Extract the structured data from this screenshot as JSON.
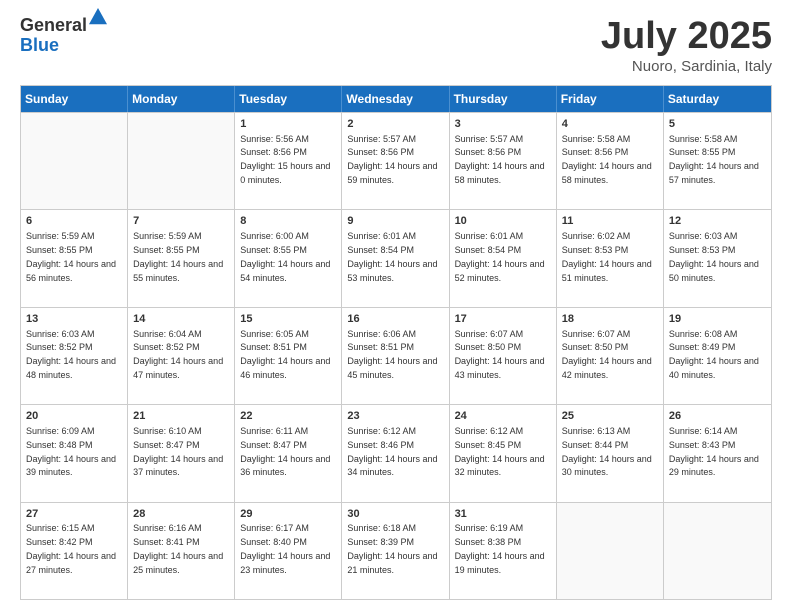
{
  "logo": {
    "general": "General",
    "blue": "Blue"
  },
  "header": {
    "month_year": "July 2025",
    "location": "Nuoro, Sardinia, Italy"
  },
  "weekdays": [
    "Sunday",
    "Monday",
    "Tuesday",
    "Wednesday",
    "Thursday",
    "Friday",
    "Saturday"
  ],
  "rows": [
    [
      {
        "day": "",
        "sunrise": "",
        "sunset": "",
        "daylight": ""
      },
      {
        "day": "",
        "sunrise": "",
        "sunset": "",
        "daylight": ""
      },
      {
        "day": "1",
        "sunrise": "Sunrise: 5:56 AM",
        "sunset": "Sunset: 8:56 PM",
        "daylight": "Daylight: 15 hours and 0 minutes."
      },
      {
        "day": "2",
        "sunrise": "Sunrise: 5:57 AM",
        "sunset": "Sunset: 8:56 PM",
        "daylight": "Daylight: 14 hours and 59 minutes."
      },
      {
        "day": "3",
        "sunrise": "Sunrise: 5:57 AM",
        "sunset": "Sunset: 8:56 PM",
        "daylight": "Daylight: 14 hours and 58 minutes."
      },
      {
        "day": "4",
        "sunrise": "Sunrise: 5:58 AM",
        "sunset": "Sunset: 8:56 PM",
        "daylight": "Daylight: 14 hours and 58 minutes."
      },
      {
        "day": "5",
        "sunrise": "Sunrise: 5:58 AM",
        "sunset": "Sunset: 8:55 PM",
        "daylight": "Daylight: 14 hours and 57 minutes."
      }
    ],
    [
      {
        "day": "6",
        "sunrise": "Sunrise: 5:59 AM",
        "sunset": "Sunset: 8:55 PM",
        "daylight": "Daylight: 14 hours and 56 minutes."
      },
      {
        "day": "7",
        "sunrise": "Sunrise: 5:59 AM",
        "sunset": "Sunset: 8:55 PM",
        "daylight": "Daylight: 14 hours and 55 minutes."
      },
      {
        "day": "8",
        "sunrise": "Sunrise: 6:00 AM",
        "sunset": "Sunset: 8:55 PM",
        "daylight": "Daylight: 14 hours and 54 minutes."
      },
      {
        "day": "9",
        "sunrise": "Sunrise: 6:01 AM",
        "sunset": "Sunset: 8:54 PM",
        "daylight": "Daylight: 14 hours and 53 minutes."
      },
      {
        "day": "10",
        "sunrise": "Sunrise: 6:01 AM",
        "sunset": "Sunset: 8:54 PM",
        "daylight": "Daylight: 14 hours and 52 minutes."
      },
      {
        "day": "11",
        "sunrise": "Sunrise: 6:02 AM",
        "sunset": "Sunset: 8:53 PM",
        "daylight": "Daylight: 14 hours and 51 minutes."
      },
      {
        "day": "12",
        "sunrise": "Sunrise: 6:03 AM",
        "sunset": "Sunset: 8:53 PM",
        "daylight": "Daylight: 14 hours and 50 minutes."
      }
    ],
    [
      {
        "day": "13",
        "sunrise": "Sunrise: 6:03 AM",
        "sunset": "Sunset: 8:52 PM",
        "daylight": "Daylight: 14 hours and 48 minutes."
      },
      {
        "day": "14",
        "sunrise": "Sunrise: 6:04 AM",
        "sunset": "Sunset: 8:52 PM",
        "daylight": "Daylight: 14 hours and 47 minutes."
      },
      {
        "day": "15",
        "sunrise": "Sunrise: 6:05 AM",
        "sunset": "Sunset: 8:51 PM",
        "daylight": "Daylight: 14 hours and 46 minutes."
      },
      {
        "day": "16",
        "sunrise": "Sunrise: 6:06 AM",
        "sunset": "Sunset: 8:51 PM",
        "daylight": "Daylight: 14 hours and 45 minutes."
      },
      {
        "day": "17",
        "sunrise": "Sunrise: 6:07 AM",
        "sunset": "Sunset: 8:50 PM",
        "daylight": "Daylight: 14 hours and 43 minutes."
      },
      {
        "day": "18",
        "sunrise": "Sunrise: 6:07 AM",
        "sunset": "Sunset: 8:50 PM",
        "daylight": "Daylight: 14 hours and 42 minutes."
      },
      {
        "day": "19",
        "sunrise": "Sunrise: 6:08 AM",
        "sunset": "Sunset: 8:49 PM",
        "daylight": "Daylight: 14 hours and 40 minutes."
      }
    ],
    [
      {
        "day": "20",
        "sunrise": "Sunrise: 6:09 AM",
        "sunset": "Sunset: 8:48 PM",
        "daylight": "Daylight: 14 hours and 39 minutes."
      },
      {
        "day": "21",
        "sunrise": "Sunrise: 6:10 AM",
        "sunset": "Sunset: 8:47 PM",
        "daylight": "Daylight: 14 hours and 37 minutes."
      },
      {
        "day": "22",
        "sunrise": "Sunrise: 6:11 AM",
        "sunset": "Sunset: 8:47 PM",
        "daylight": "Daylight: 14 hours and 36 minutes."
      },
      {
        "day": "23",
        "sunrise": "Sunrise: 6:12 AM",
        "sunset": "Sunset: 8:46 PM",
        "daylight": "Daylight: 14 hours and 34 minutes."
      },
      {
        "day": "24",
        "sunrise": "Sunrise: 6:12 AM",
        "sunset": "Sunset: 8:45 PM",
        "daylight": "Daylight: 14 hours and 32 minutes."
      },
      {
        "day": "25",
        "sunrise": "Sunrise: 6:13 AM",
        "sunset": "Sunset: 8:44 PM",
        "daylight": "Daylight: 14 hours and 30 minutes."
      },
      {
        "day": "26",
        "sunrise": "Sunrise: 6:14 AM",
        "sunset": "Sunset: 8:43 PM",
        "daylight": "Daylight: 14 hours and 29 minutes."
      }
    ],
    [
      {
        "day": "27",
        "sunrise": "Sunrise: 6:15 AM",
        "sunset": "Sunset: 8:42 PM",
        "daylight": "Daylight: 14 hours and 27 minutes."
      },
      {
        "day": "28",
        "sunrise": "Sunrise: 6:16 AM",
        "sunset": "Sunset: 8:41 PM",
        "daylight": "Daylight: 14 hours and 25 minutes."
      },
      {
        "day": "29",
        "sunrise": "Sunrise: 6:17 AM",
        "sunset": "Sunset: 8:40 PM",
        "daylight": "Daylight: 14 hours and 23 minutes."
      },
      {
        "day": "30",
        "sunrise": "Sunrise: 6:18 AM",
        "sunset": "Sunset: 8:39 PM",
        "daylight": "Daylight: 14 hours and 21 minutes."
      },
      {
        "day": "31",
        "sunrise": "Sunrise: 6:19 AM",
        "sunset": "Sunset: 8:38 PM",
        "daylight": "Daylight: 14 hours and 19 minutes."
      },
      {
        "day": "",
        "sunrise": "",
        "sunset": "",
        "daylight": ""
      },
      {
        "day": "",
        "sunrise": "",
        "sunset": "",
        "daylight": ""
      }
    ]
  ]
}
